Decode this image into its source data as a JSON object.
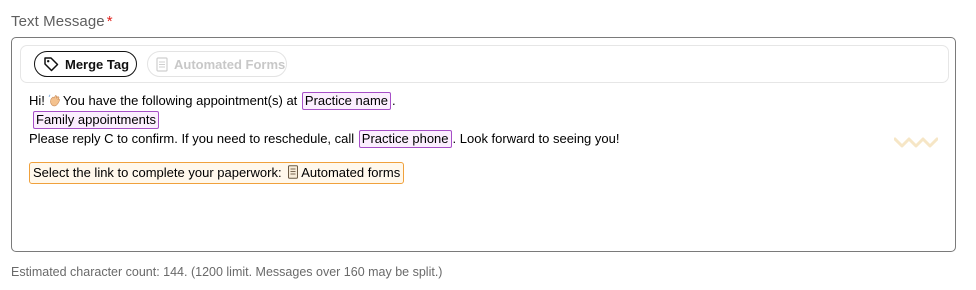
{
  "field": {
    "label": "Text Message",
    "required_mark": "*"
  },
  "toolbar": {
    "merge_tag_label": "Merge Tag",
    "automated_forms_label": "Automated Forms"
  },
  "message": {
    "greeting": "Hi!",
    "line1_text": "You have the following appointment(s) at",
    "tag_practice_name": "Practice name",
    "line1_end": ".",
    "tag_family_appointments": "Family appointments",
    "line3_text": "Please reply C to confirm. If you need to reschedule, call",
    "tag_practice_phone": "Practice phone",
    "line3_end": ". Look forward to seeing you!",
    "forms_prompt": "Select the link to complete your paperwork:",
    "forms_link": "Automated forms"
  },
  "hint": {
    "text": "Estimated character count: 144. (1200 limit. Messages over 160 may be split.)"
  },
  "colors": {
    "required": "#e0201b",
    "merge_tag_border": "#a64fc7",
    "merge_tag_bg": "#fbeefe",
    "forms_border": "#f0a13c",
    "forms_bg": "#fff8ec"
  },
  "icons": {
    "merge_tag": "tag-icon",
    "automated_forms": "document-icon",
    "greeting": "waving-hand-icon",
    "forms_link": "document-icon"
  }
}
